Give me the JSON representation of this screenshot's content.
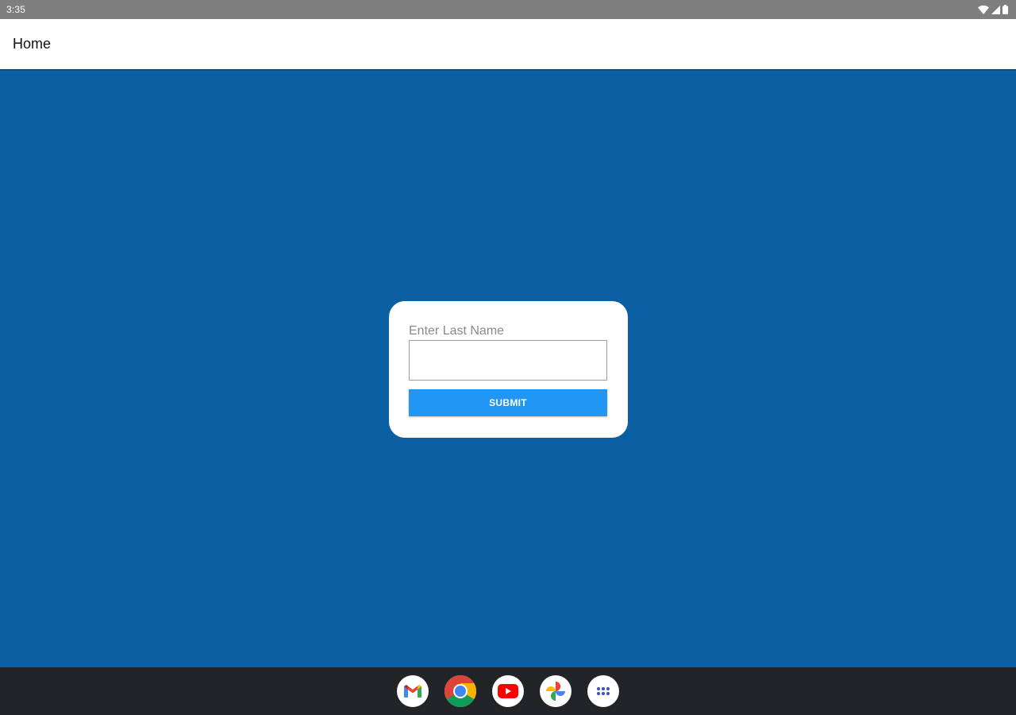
{
  "status_bar": {
    "time": "3:35",
    "icons": [
      "wifi-icon",
      "signal-icon",
      "battery-icon"
    ]
  },
  "app_bar": {
    "title": "Home"
  },
  "form": {
    "label": "Enter Last Name",
    "input_value": "",
    "submit_label": "SUBMIT"
  },
  "taskbar": {
    "apps": [
      "gmail-icon",
      "chrome-icon",
      "youtube-icon",
      "photos-icon",
      "app-drawer-icon"
    ]
  },
  "colors": {
    "status_bar": "#7f7f7f",
    "background": "#0a5fa3",
    "button": "#2196f3",
    "taskbar": "#232428"
  }
}
